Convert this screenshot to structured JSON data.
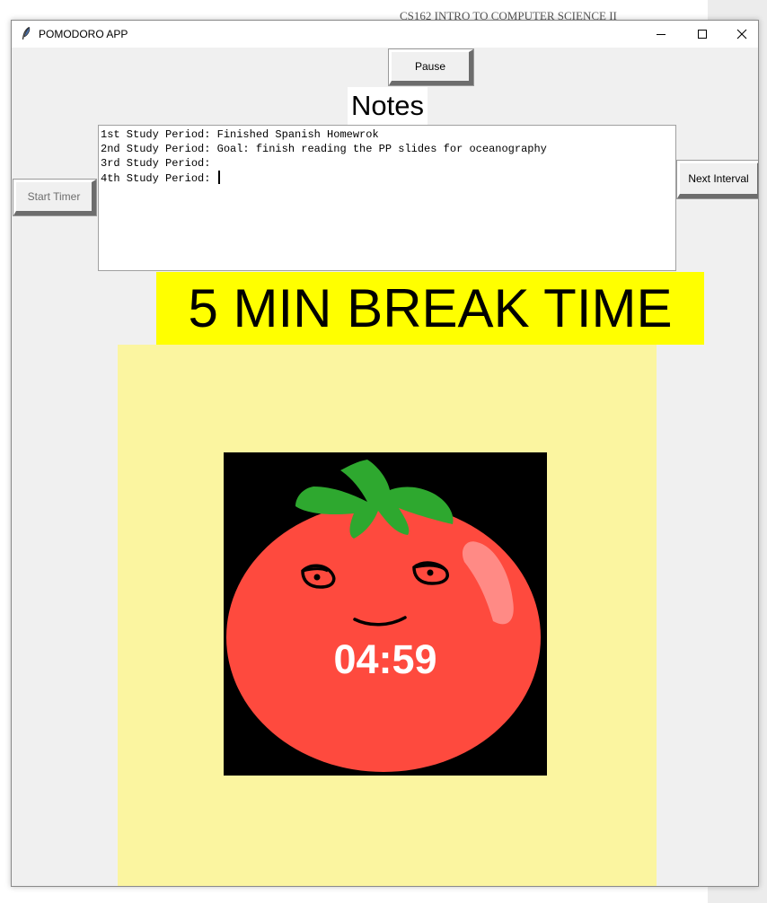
{
  "background": {
    "document_header": "CS162 INTRO TO COMPUTER SCIENCE II"
  },
  "window": {
    "title": "POMODORO APP",
    "icon": "feather-icon",
    "controls": [
      "minimize-icon",
      "maximize-icon",
      "close-icon"
    ]
  },
  "buttons": {
    "pause": "Pause",
    "start_timer": "Start Timer",
    "next_interval": "Next Interval"
  },
  "notes": {
    "heading": "Notes",
    "lines": [
      "1st Study Period: Finished Spanish Homewrok",
      "2nd Study Period: Goal: finish reading the PP slides for oceanography",
      "3rd Study Period:",
      "4th Study Period: "
    ]
  },
  "status_banner": "5 MIN BREAK TIME",
  "timer": {
    "display": "04:59"
  },
  "colors": {
    "banner": "#ffff00",
    "canvas_panel": "#fbf5a0",
    "tomato": "#fe4a3e",
    "leaves": "#2ea82f",
    "highlight": "#ff8a85",
    "timer_text": "#ffffff"
  }
}
